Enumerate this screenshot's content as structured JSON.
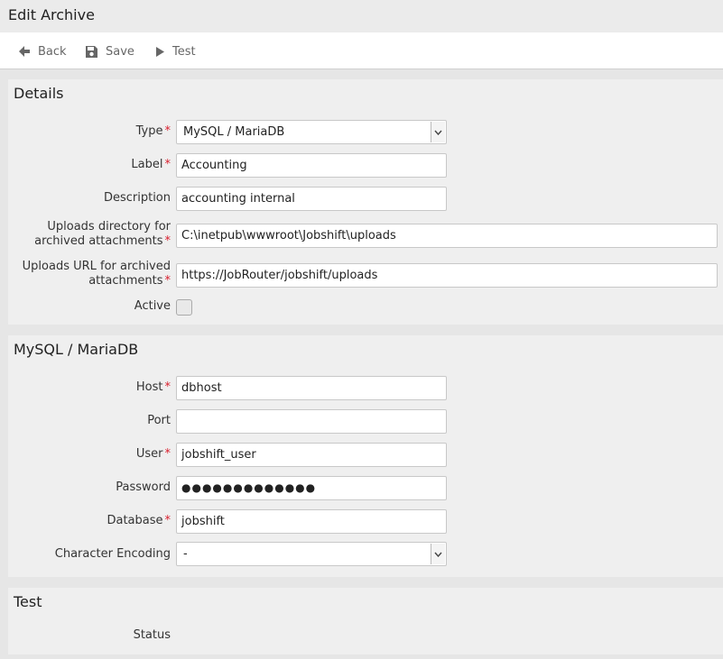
{
  "title": "Edit Archive",
  "toolbar": {
    "back_label": "Back",
    "save_label": "Save",
    "test_label": "Test"
  },
  "details": {
    "heading": "Details",
    "type_label": "Type",
    "type_value": "MySQL / MariaDB",
    "label_label": "Label",
    "label_value": "Accounting",
    "description_label": "Description",
    "description_value": "accounting internal",
    "uploads_dir_label_line1": "Uploads directory for",
    "uploads_dir_label_line2": "archived attachments",
    "uploads_dir_value": "C:\\inetpub\\wwwroot\\Jobshift\\uploads",
    "uploads_url_label_line1": "Uploads URL for archived",
    "uploads_url_label_line2": "attachments",
    "uploads_url_value": "https://JobRouter/jobshift/uploads",
    "active_label": "Active",
    "active_checked": false
  },
  "mysql": {
    "heading": "MySQL / MariaDB",
    "host_label": "Host",
    "host_value": "dbhost",
    "port_label": "Port",
    "port_value": "",
    "user_label": "User",
    "user_value": "jobshift_user",
    "password_label": "Password",
    "password_value": "●●●●●●●●●●●●●",
    "database_label": "Database",
    "database_value": "jobshift",
    "encoding_label": "Character Encoding",
    "encoding_value": "-"
  },
  "test": {
    "heading": "Test",
    "status_label": "Status"
  },
  "required_marker": "*",
  "colors": {
    "required": "#d9202f",
    "panel_bg": "#efefef",
    "page_bg": "#e6e6e6"
  }
}
